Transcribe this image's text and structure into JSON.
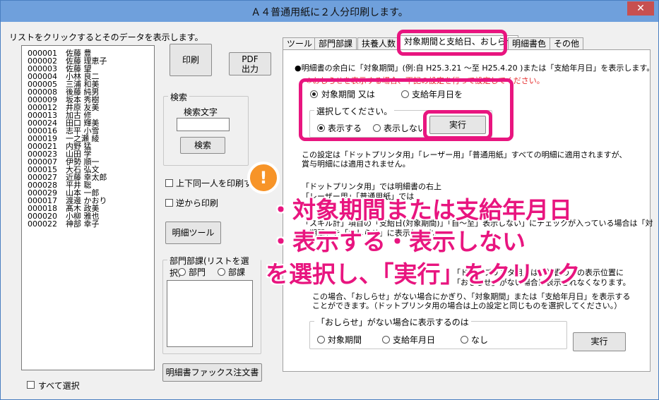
{
  "window": {
    "title": "Ａ４普通用紙に２人分印刷します。",
    "close": "✕"
  },
  "left": {
    "list_caption": "リストをクリックするとそのデータを表示します。",
    "employees": [
      {
        "code": "000001",
        "name": "佐藤 豊"
      },
      {
        "code": "000002",
        "name": "佐藤 理恵子"
      },
      {
        "code": "000003",
        "name": "佐藤 望"
      },
      {
        "code": "000004",
        "name": "小林 良二"
      },
      {
        "code": "000005",
        "name": "三浦 和美"
      },
      {
        "code": "000008",
        "name": "後藤 純男"
      },
      {
        "code": "000009",
        "name": "坂本 秀樹"
      },
      {
        "code": "000012",
        "name": "井原 友美"
      },
      {
        "code": "000013",
        "name": "加古 修"
      },
      {
        "code": "000024",
        "name": "田口 輝美"
      },
      {
        "code": "000016",
        "name": "志平 小雪"
      },
      {
        "code": "000019",
        "name": "一之瀬 綾"
      },
      {
        "code": "000021",
        "name": "内野 猛"
      },
      {
        "code": "000023",
        "name": "山田 学"
      },
      {
        "code": "000007",
        "name": "伊勢 順一"
      },
      {
        "code": "000015",
        "name": "大石 弘文"
      },
      {
        "code": "000027",
        "name": "近藤 幸太郎"
      },
      {
        "code": "000028",
        "name": "平井 聡"
      },
      {
        "code": "000029",
        "name": "山本 一郎"
      },
      {
        "code": "000017",
        "name": "渡邊 かおり"
      },
      {
        "code": "000018",
        "name": "髙木 政美"
      },
      {
        "code": "000020",
        "name": "小柳 雅也"
      },
      {
        "code": "000022",
        "name": "神部 幸子"
      }
    ],
    "select_all": "すべて選択"
  },
  "middle": {
    "print": "印刷",
    "pdf": "PDF\n出力",
    "search_group": "検索",
    "search_label": "検索文字",
    "search_value": "",
    "search_button": "検索",
    "same_person": "上下同一人を印刷す",
    "reverse_print": "逆から印刷",
    "meisai_tool": "明細ツール",
    "dept_group": "部門部課(リストを選択)",
    "dept_radio1": "部門",
    "dept_radio2": "部課",
    "fax_order": "明細書ファックス注文書"
  },
  "tabs": [
    "ツール",
    "部門部課",
    "扶養人数",
    "対象期間と支給日、おしらせ",
    "明細書色",
    "その他"
  ],
  "panel": {
    "line1": "●明細書の余白に「対象期間」(例:自 H25.3.21 ～至 H25.4.20 )または「支給年月日」を表示します。",
    "line2_red": "※おしらせを表示する場合、下記の設定を行って設定してください。",
    "radio_period": "対象期間 又は",
    "radio_paydate": "支給年月日を",
    "choose_group": "選択してください。",
    "radio_show": "表示する",
    "radio_hide": "表示しない",
    "run": "実行",
    "note1": "この設定は「ドットプリンタ用」「レーザー用」「普通用紙」すべての明細に適用されますが、賞与明細には適用されません。",
    "note2a": "「ドットプリンタ用」では明細書の右上",
    "note2b": "「レーザー用」「普通用紙」では",
    "note3": "「スキル計」項目の「支給日(対象期間)」「自～至」表示しない」にチェックが入っている場合は「対",
    "note4": "象期間」を「おしらせ」に表示します。",
    "note5": "「ドットプリンタ用」は明細書の下の表示位置に",
    "note6": "「おしらせ」がない場合は表示されなくなります。",
    "note7": "この場合、「おしらせ」がない場合にかぎり、「対象期間」または「支給年月日」を表示することができます。（ドットプリンタ用の場合は上の設定と同じものを選択してください。）",
    "no_notice_group": "「おしらせ」がない場合に表示するのは",
    "opt_period": "対象期間",
    "opt_paydate": "支給年月日",
    "opt_none": "なし",
    "run2": "実行"
  },
  "annotation": {
    "icon": "!",
    "line1": "・対象期間または支給年月日",
    "line2": "・表示する・表示しない",
    "line3": "を選択し、「実行」をクリック",
    "color": "#e8157f"
  }
}
